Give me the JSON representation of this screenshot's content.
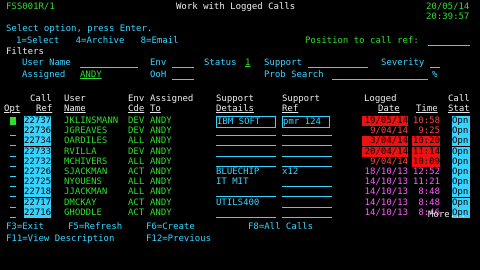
{
  "header": {
    "program": "FSS001R/1",
    "title": "Work with Logged Calls",
    "date": "20/05/14",
    "time": "20:39:57"
  },
  "instructions": {
    "line1": "Select option, press Enter.",
    "options": "1=Select   4=Archive   8=Email",
    "position_label": "Position to call ref:"
  },
  "filters": {
    "heading": "Filters",
    "user_name_label": "User Name",
    "env_label": "Env",
    "status_label": "Status",
    "status_value": "1",
    "support_label": "Support",
    "severity_label": "Severity",
    "assigned_label": "Assigned",
    "assigned_value": "ANDY",
    "ooh_label": "OoH",
    "prob_search_label": "Prob Search",
    "percent": "%"
  },
  "columns": {
    "h1": {
      "opt": "",
      "call": "Call",
      "user": "User",
      "env": "Env",
      "assigned": "Assigned",
      "supd": "Support",
      "supr": "Support",
      "logged": "Logged",
      "time": "",
      "stat": "Call"
    },
    "h2": {
      "opt": "Opt",
      "call": "Ref",
      "user": "Name",
      "env": "Cde",
      "assigned": "To",
      "supd": "Details",
      "supr": "Ref",
      "logged": "Date",
      "time": "Time",
      "stat": "Stat"
    }
  },
  "rows": [
    {
      "call": "22737",
      "user": "JKLINSMANN",
      "env": "DEV",
      "assigned": "ANDY",
      "supd": "IBM SOFT",
      "supr": "pmr 124",
      "date": "19/05/14",
      "time": "10:58",
      "stat": "Opn"
    },
    {
      "call": "22736",
      "user": "JGREAVES",
      "env": "DEV",
      "assigned": "ANDY",
      "supd": "",
      "supr": "",
      "date": "9/04/14",
      "time": "9:25",
      "stat": "Opn"
    },
    {
      "call": "22734",
      "user": "OARDILES",
      "env": "ALL",
      "assigned": "ANDY",
      "supd": "",
      "supr": "",
      "date": "3/04/14",
      "time": "10:20",
      "stat": "Opn"
    },
    {
      "call": "22733",
      "user": "RVILLA",
      "env": "DEV",
      "assigned": "ANDY",
      "supd": "",
      "supr": "",
      "date": "20/04/14",
      "time": "11:14",
      "stat": "Opn"
    },
    {
      "call": "22732",
      "user": "MCHIVERS",
      "env": "ALL",
      "assigned": "ANDY",
      "supd": "",
      "supr": "",
      "date": "9/04/14",
      "time": "10:09",
      "stat": "Opn"
    },
    {
      "call": "22726",
      "user": "SJACKMAN",
      "env": "ACT",
      "assigned": "ANDY",
      "supd": "BLUECHIP",
      "supr": "x12",
      "date": "18/10/13",
      "time": "12:52",
      "stat": "Opn"
    },
    {
      "call": "22725",
      "user": "NYOUENS",
      "env": "ALL",
      "assigned": "ANDY",
      "supd": "IT MIT",
      "supr": "",
      "date": "14/10/13",
      "time": "11:21",
      "stat": "Opn"
    },
    {
      "call": "22718",
      "user": "JJACKMAN",
      "env": "ALL",
      "assigned": "ANDY",
      "supd": "",
      "supr": "",
      "date": "14/10/13",
      "time": "8:48",
      "stat": "Opn"
    },
    {
      "call": "22717",
      "user": "DMCKAY",
      "env": "ACT",
      "assigned": "ANDY",
      "supd": "UTILS400",
      "supr": "",
      "date": "14/10/13",
      "time": "8:48",
      "stat": "Opn"
    },
    {
      "call": "22716",
      "user": "GHODDLE",
      "env": "ACT",
      "assigned": "ANDY",
      "supd": "",
      "supr": "",
      "date": "14/10/13",
      "time": "8:46",
      "stat": "Opn"
    }
  ],
  "more": "More...",
  "footer": {
    "f3": "F3=Exit",
    "f5": "F5=Refresh",
    "f6": "F6=Create",
    "f8": "F8=All Calls",
    "f11": "F11=View Description",
    "f12": "F12=Previous"
  },
  "colors": {
    "cyan": "#37d3ff",
    "green": "#2edc2e",
    "pink": "#ff5bff",
    "red": "#e11111",
    "white": "#e8e8e8"
  }
}
